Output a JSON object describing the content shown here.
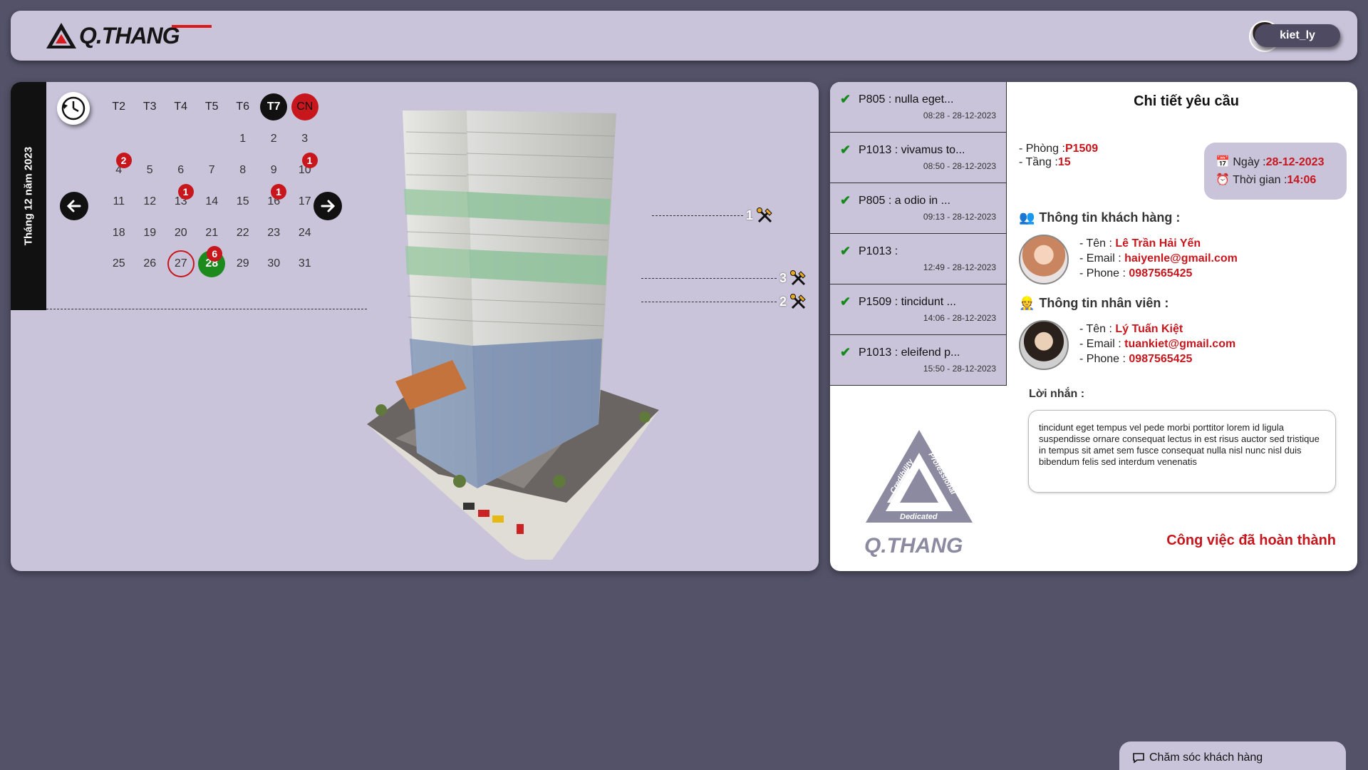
{
  "header": {
    "logo_text": "Q.THANG",
    "username": "kiet_ly"
  },
  "calendar": {
    "month_label": "Tháng 12 năm 2023",
    "weekdays": [
      "T2",
      "T3",
      "T4",
      "T5",
      "T6",
      "T7",
      "CN"
    ],
    "weeks": [
      [
        "",
        "",
        "",
        "",
        "1",
        "2",
        "3"
      ],
      [
        "4",
        "5",
        "6",
        "7",
        "8",
        "9",
        "10"
      ],
      [
        "11",
        "12",
        "13",
        "14",
        "15",
        "16",
        "17"
      ],
      [
        "18",
        "19",
        "20",
        "21",
        "22",
        "23",
        "24"
      ],
      [
        "25",
        "26",
        "27",
        "28",
        "29",
        "30",
        "31"
      ]
    ],
    "badges": {
      "4": "2",
      "10": "1",
      "13": "1",
      "16": "1",
      "28": "6"
    },
    "today": "27",
    "selected": "28"
  },
  "building_markers": [
    {
      "label": "1"
    },
    {
      "label": "3"
    },
    {
      "label": "2"
    }
  ],
  "requests": [
    {
      "title": "P805 : nulla eget...",
      "time": "08:28 - 28-12-2023"
    },
    {
      "title": "P1013 : vivamus to...",
      "time": "08:50 - 28-12-2023"
    },
    {
      "title": "P805 : a odio in ...",
      "time": "09:13 - 28-12-2023"
    },
    {
      "title": "P1013 :",
      "time": "12:49 - 28-12-2023"
    },
    {
      "title": "P1509 : tincidunt ...",
      "time": "14:06 - 28-12-2023"
    },
    {
      "title": "P1013 : eleifend p...",
      "time": "15:50 - 28-12-2023"
    }
  ],
  "detail": {
    "title": "Chi tiết yêu cầu",
    "room_label": "- Phòng :",
    "room": "P1509",
    "floor_label": "- Tầng :",
    "floor": "15",
    "date_label": "Ngày :",
    "date": "28-12-2023",
    "time_label": "Thời gian :",
    "time": "14:06",
    "customer_heading": "Thông tin khách hàng :",
    "customer": {
      "name": "Lê Trần Hải Yến",
      "email": "haiyenle@gmail.com",
      "phone": "0987565425"
    },
    "staff_heading": "Thông tin nhân viên :",
    "staff": {
      "name": "Lý Tuấn Kiệt",
      "email": "tuankiet@gmail.com",
      "phone": "0987565425"
    },
    "name_label": "- Tên :",
    "email_label": "- Email :",
    "phone_label": "- Phone :",
    "message_label": "Lời nhắn :",
    "message": "tincidunt eget tempus vel pede morbi porttitor lorem id ligula suspendisse ornare consequat lectus in est risus auctor sed tristique in tempus sit amet sem fusce consequat nulla nisl nunc nisl duis bibendum felis sed interdum venenatis",
    "status": "Công việc đã hoàn thành"
  },
  "big_logo": {
    "text": "Q.THANG",
    "words": [
      "Credibility",
      "Professional",
      "Dedicated"
    ]
  },
  "chat": {
    "label": "Chăm sóc khách hàng"
  },
  "colors": {
    "background": "#545268",
    "panel": "#c9c4da",
    "accent_red": "#c8161d",
    "selected_green": "#1c8a1c"
  }
}
